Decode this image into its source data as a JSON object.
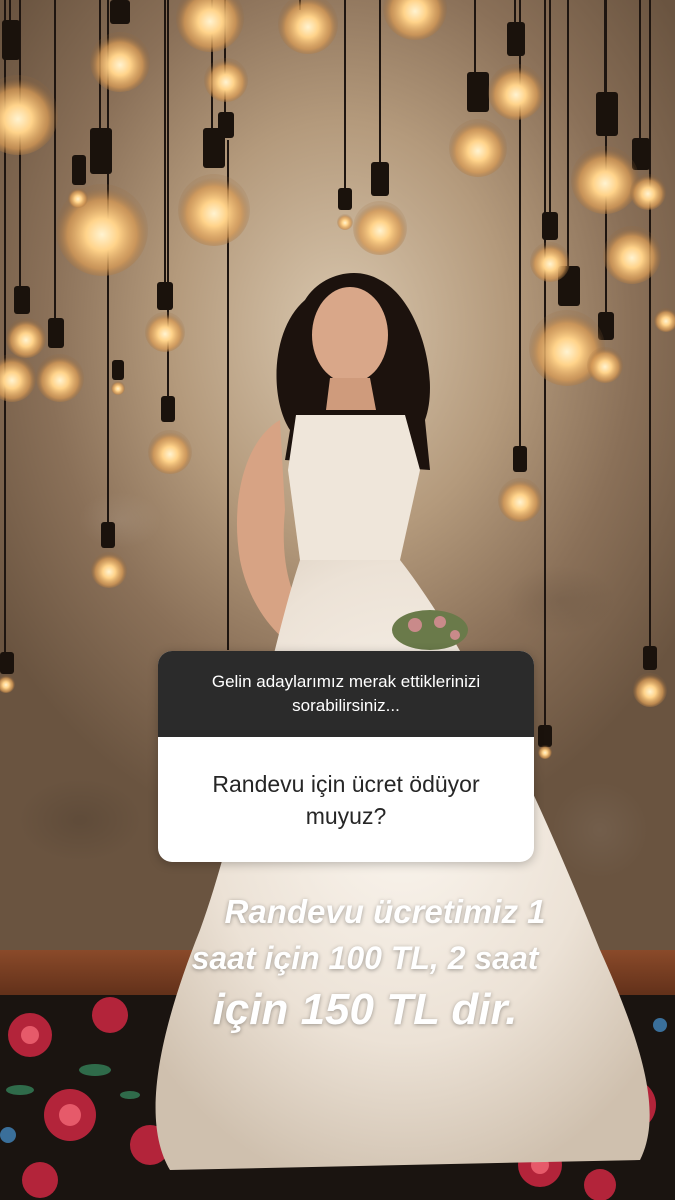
{
  "story": {
    "question_sticker": {
      "prompt": "Gelin adaylarımız merak ettiklerinizi sorabilirsiniz...",
      "question": "Randevu için ücret ödüyor muyuz?"
    },
    "answer_text": {
      "line1": "Randevu ücretimiz 1",
      "line2": "saat için 100 TL, 2 saat",
      "line3": "için 150 TL dir."
    },
    "background": {
      "description_icon": "photo-bride-with-edison-bulbs",
      "colors": {
        "wall": "#c8b394",
        "bulb_glow": "#ffd79a",
        "dress": "#f2ece6",
        "rug_red": "#c0283a",
        "floor": "#7a3e22"
      }
    }
  }
}
